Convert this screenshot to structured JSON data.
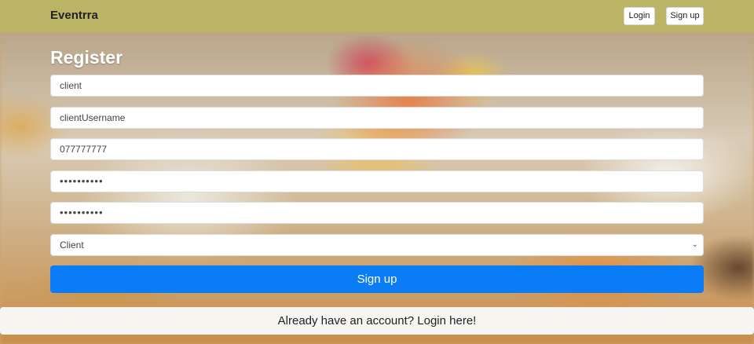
{
  "navbar": {
    "brand": "Eventrra",
    "login_label": "Login",
    "signup_label": "Sign up"
  },
  "form": {
    "title": "Register",
    "name_value": "client",
    "username_value": "clientUsername",
    "phone_value": "077777777",
    "password_value": "••••••••••",
    "confirm_password_value": "••••••••••",
    "role_selected": "Client",
    "submit_label": "Sign up"
  },
  "footer": {
    "login_link": "Already have an account? Login here!"
  },
  "colors": {
    "navbar_bg": "#bcb465",
    "primary_button": "#0a7cf5"
  }
}
